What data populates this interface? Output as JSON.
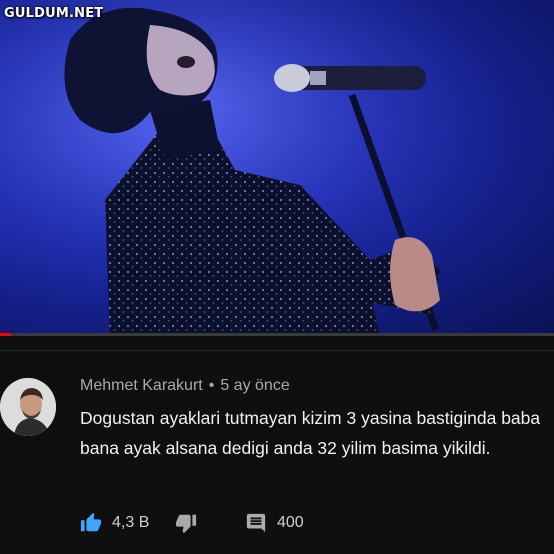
{
  "watermark": "GULDUM.NET",
  "video": {
    "progress_fraction": 0.02
  },
  "comment": {
    "author": "Mehmet Karakurt",
    "separator": "•",
    "time": "5 ay önce",
    "text": "Dogustan ayaklari tutmayan kizim 3 yasina bastiginda baba bana ayak alsana dedigi anda 32 yilim basima yikildi.",
    "like_count": "4,3 B",
    "reply_count": "400"
  },
  "colors": {
    "like_blue": "#3ea6ff",
    "progress_red": "#ff0000",
    "icon_gray": "#aaaaaa"
  },
  "icons": {
    "like": "thumbs-up-icon",
    "dislike": "thumbs-down-icon",
    "reply": "comment-icon"
  }
}
